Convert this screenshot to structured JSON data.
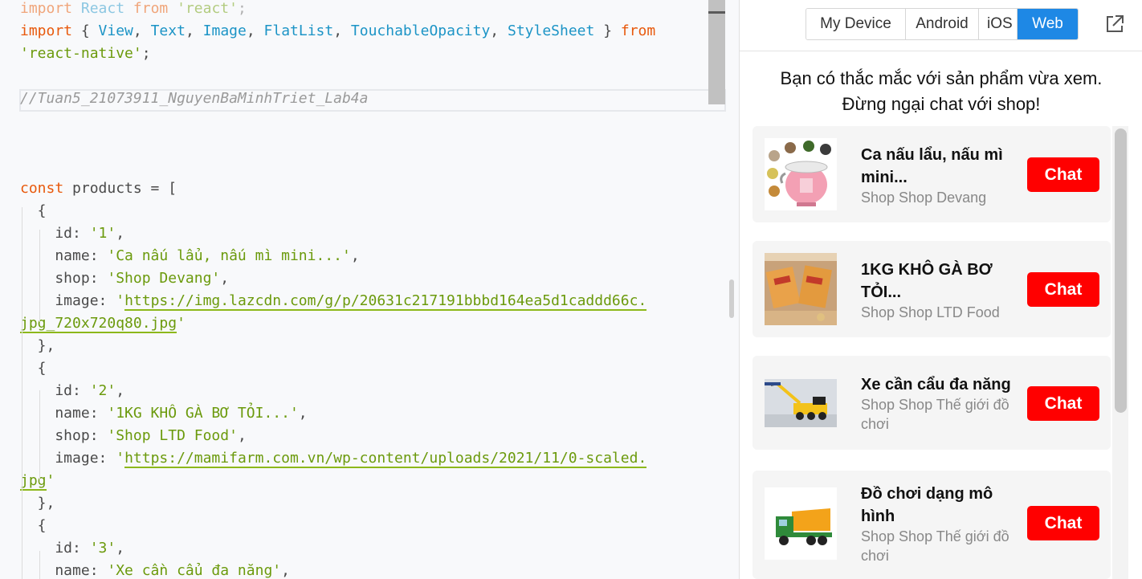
{
  "editor": {
    "lines": [
      [
        [
          "kwf",
          "import"
        ],
        [
          "plf",
          " "
        ],
        [
          "idf",
          "React"
        ],
        [
          "plf",
          " "
        ],
        [
          "kwf",
          "from"
        ],
        [
          "plf",
          " "
        ],
        [
          "strf",
          "'react'"
        ],
        [
          "plf",
          ";"
        ]
      ],
      [
        [
          "kw",
          "import"
        ],
        [
          "pl",
          " { "
        ],
        [
          "id",
          "View"
        ],
        [
          "pl",
          ", "
        ],
        [
          "id",
          "Text"
        ],
        [
          "pl",
          ", "
        ],
        [
          "id",
          "Image"
        ],
        [
          "pl",
          ", "
        ],
        [
          "id",
          "FlatList"
        ],
        [
          "pl",
          ", "
        ],
        [
          "id",
          "TouchableOpacity"
        ],
        [
          "pl",
          ", "
        ],
        [
          "id",
          "StyleSheet"
        ],
        [
          "pl",
          " } "
        ],
        [
          "kw",
          "from"
        ]
      ],
      [
        [
          "str",
          "'react-native'"
        ],
        [
          "pl",
          ";"
        ]
      ],
      [],
      [
        [
          "cmt",
          "//Tuan5_21073911_NguyenBaMinhTriet_Lab4a"
        ]
      ],
      [],
      [],
      [],
      [
        [
          "kw",
          "const"
        ],
        [
          "pl",
          " products = ["
        ]
      ],
      [
        [
          "pl",
          "  {"
        ]
      ],
      [
        [
          "pl",
          "    id: "
        ],
        [
          "str",
          "'1'"
        ],
        [
          "pl",
          ","
        ]
      ],
      [
        [
          "pl",
          "    name: "
        ],
        [
          "str",
          "'Ca nấu lẩu, nấu mì mini...'"
        ],
        [
          "pl",
          ","
        ]
      ],
      [
        [
          "pl",
          "    shop: "
        ],
        [
          "str",
          "'Shop Devang'"
        ],
        [
          "pl",
          ","
        ]
      ],
      [
        [
          "pl",
          "    image: "
        ],
        [
          "str",
          "'"
        ],
        [
          "url",
          "https://img.lazcdn.com/g/p/20631c217191bbbd164ea5d1caddd66c."
        ]
      ],
      [
        [
          "url",
          "jpg_720x720q80.jpg"
        ],
        [
          "str",
          "'"
        ]
      ],
      [
        [
          "pl",
          "  },"
        ]
      ],
      [
        [
          "pl",
          "  {"
        ]
      ],
      [
        [
          "pl",
          "    id: "
        ],
        [
          "str",
          "'2'"
        ],
        [
          "pl",
          ","
        ]
      ],
      [
        [
          "pl",
          "    name: "
        ],
        [
          "str",
          "'1KG KHÔ GÀ BƠ TỎI...'"
        ],
        [
          "pl",
          ","
        ]
      ],
      [
        [
          "pl",
          "    shop: "
        ],
        [
          "str",
          "'Shop LTD Food'"
        ],
        [
          "pl",
          ","
        ]
      ],
      [
        [
          "pl",
          "    image: "
        ],
        [
          "str",
          "'"
        ],
        [
          "url",
          "https://mamifarm.com.vn/wp-content/uploads/2021/11/0-scaled."
        ]
      ],
      [
        [
          "url",
          "jpg"
        ],
        [
          "str",
          "'"
        ]
      ],
      [
        [
          "pl",
          "  },"
        ]
      ],
      [
        [
          "pl",
          "  {"
        ]
      ],
      [
        [
          "pl",
          "    id: "
        ],
        [
          "str",
          "'3'"
        ],
        [
          "pl",
          ","
        ]
      ],
      [
        [
          "pl",
          "    name: "
        ],
        [
          "str",
          "'Xe cần cẩu đa năng'"
        ],
        [
          "pl",
          ","
        ]
      ]
    ]
  },
  "preview": {
    "tabs": [
      {
        "label": "My Device",
        "active": false
      },
      {
        "label": "Android",
        "active": false
      },
      {
        "label": "iOS",
        "active": false
      },
      {
        "label": "Web",
        "active": true
      }
    ],
    "popout_icon": "external-link-icon",
    "heading_line1": "Bạn có thắc mắc với sản phẩm vừa xem.",
    "heading_line2": "Đừng ngại chat với shop!",
    "chat_color": "#ff0000",
    "products": [
      {
        "name": "Ca nấu lẩu, nấu mì mini...",
        "shop": "Shop Shop Devang",
        "chat_label": "Chat",
        "image": "pink-electric-cooker"
      },
      {
        "name": "1KG KHÔ GÀ BƠ TỎI...",
        "shop": "Shop Shop LTD Food",
        "chat_label": "Chat",
        "image": "dried-chicken-bags"
      },
      {
        "name": "Xe cần cẩu đa năng",
        "shop": "Shop Shop Thế giới đồ chơi",
        "chat_label": "Chat",
        "image": "yellow-crane-toy"
      },
      {
        "name": "Đồ chơi dạng mô hình",
        "shop": "Shop Shop Thế giới đồ chơi",
        "chat_label": "Chat",
        "image": "dump-truck-toy"
      }
    ]
  }
}
